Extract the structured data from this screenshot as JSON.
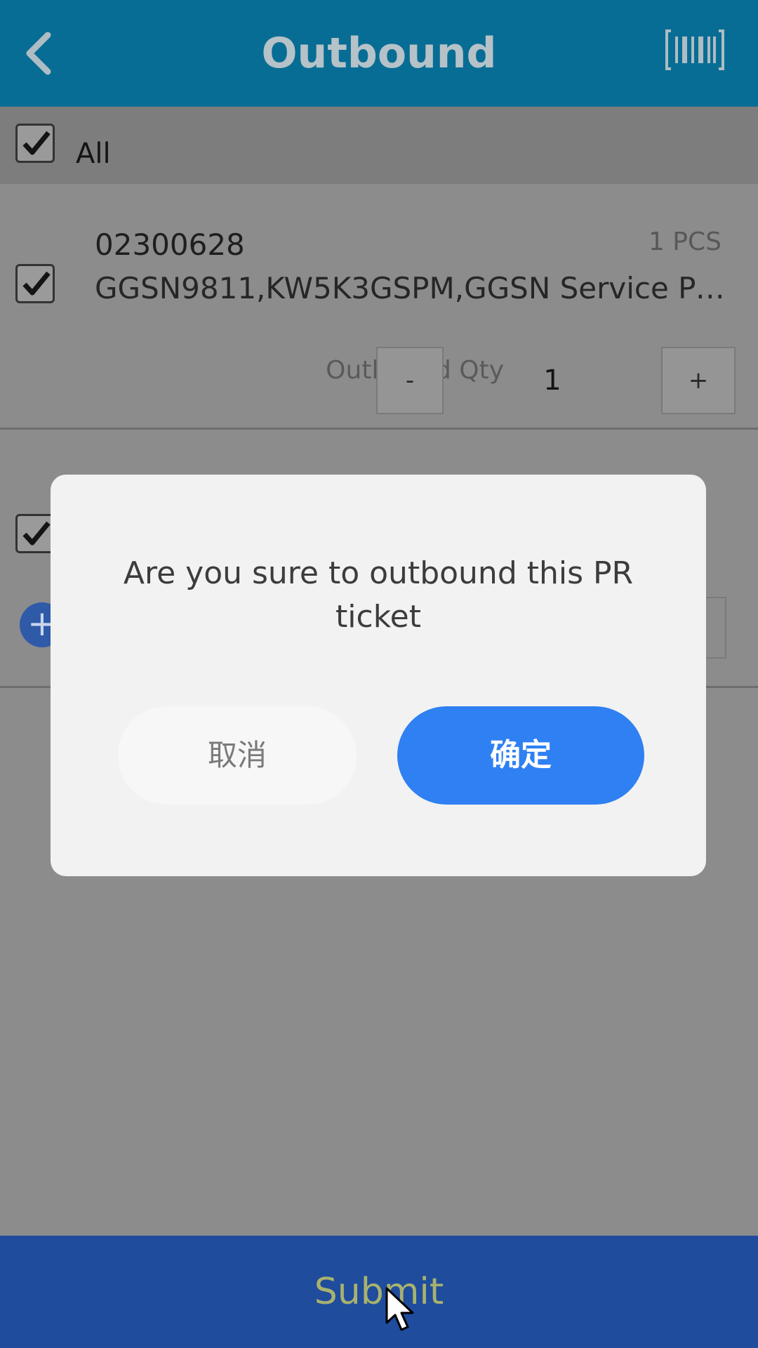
{
  "header": {
    "title": "Outbound",
    "back_icon": "chevron-left-icon",
    "scan_icon": "barcode-scan-icon"
  },
  "select_all": {
    "label": "All",
    "checked": true
  },
  "items": [
    {
      "code": "02300628",
      "quantity": "1 PCS",
      "description": "GGSN9811,KW5K3GSPM,GGSN Service Pr...",
      "checked": true,
      "outbound_qty_label": "Outbound Qty",
      "outbound_qty_value": "1",
      "minus_label": "-",
      "plus_label": "+"
    },
    {
      "checked": true,
      "add_icon": "plus-circle-icon"
    }
  ],
  "dialog": {
    "message": "Are you sure to outbound this PR ticket",
    "cancel_label": "取消",
    "confirm_label": "确定"
  },
  "footer": {
    "submit_label": "Submit"
  },
  "colors": {
    "header_bg": "#086d94",
    "submit_bg": "#1f4c9c",
    "confirm_bg": "#2f80f2",
    "overlay": "#8c8c8c"
  }
}
